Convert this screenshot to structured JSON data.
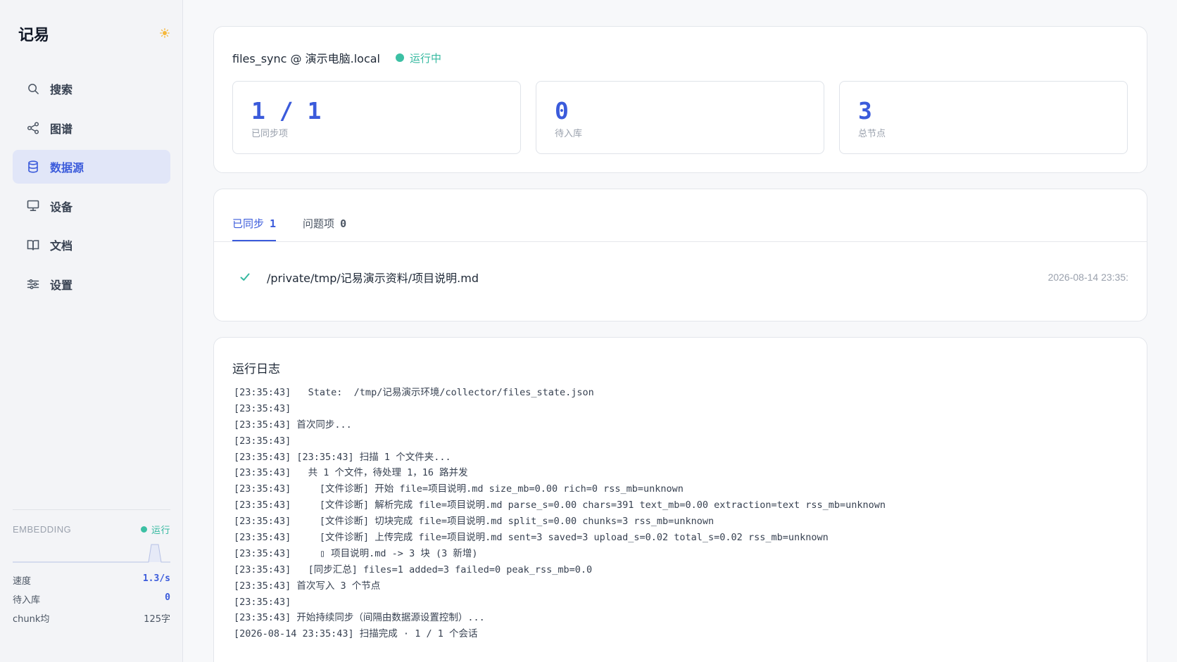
{
  "app": {
    "brand": "记易",
    "theme_icon": "sun-icon"
  },
  "sidebar": {
    "items": [
      {
        "label": "搜索",
        "icon": "search-icon"
      },
      {
        "label": "图谱",
        "icon": "graph-icon"
      },
      {
        "label": "数据源",
        "icon": "database-icon",
        "active": true
      },
      {
        "label": "设备",
        "icon": "monitor-icon"
      },
      {
        "label": "文档",
        "icon": "book-icon"
      },
      {
        "label": "设置",
        "icon": "sliders-icon"
      }
    ],
    "embedding": {
      "title": "EMBEDDING",
      "status": "运行",
      "stats": [
        {
          "label": "速度",
          "value": "1.3/s"
        },
        {
          "label": "待入库",
          "value": "0"
        },
        {
          "label": "chunk均",
          "value": "125字"
        }
      ]
    }
  },
  "source": {
    "name": "files_sync @ 演示电脑.local",
    "status": "运行中",
    "metrics": [
      {
        "value": "1 / 1",
        "label": "已同步项"
      },
      {
        "value": "0",
        "label": "待入库"
      },
      {
        "value": "3",
        "label": "总节点"
      }
    ]
  },
  "tabs": [
    {
      "label": "已同步",
      "count": "1",
      "active": true
    },
    {
      "label": "问题项",
      "count": "0"
    }
  ],
  "files": [
    {
      "path": "/private/tmp/记易演示资料/项目说明.md",
      "time": "2026-08-14 23:35:"
    }
  ],
  "log": {
    "title": "运行日志",
    "lines": [
      "[23:35:43]   State:  /tmp/记易演示环境/collector/files_state.json",
      "[23:35:43]",
      "[23:35:43] 首次同步...",
      "[23:35:43]",
      "[23:35:43] [23:35:43] 扫描 1 个文件夹...",
      "[23:35:43]   共 1 个文件，待处理 1，16 路并发",
      "[23:35:43]     [文件诊断] 开始 file=项目说明.md size_mb=0.00 rich=0 rss_mb=unknown",
      "[23:35:43]     [文件诊断] 解析完成 file=项目说明.md parse_s=0.00 chars=391 text_mb=0.00 extraction=text rss_mb=unknown",
      "[23:35:43]     [文件诊断] 切块完成 file=项目说明.md split_s=0.00 chunks=3 rss_mb=unknown",
      "[23:35:43]     [文件诊断] 上传完成 file=项目说明.md sent=3 saved=3 upload_s=0.02 total_s=0.02 rss_mb=unknown",
      "[23:35:43]     ▯ 项目说明.md -> 3 块 (3 新增)",
      "[23:35:43]   [同步汇总] files=1 added=3 failed=0 peak_rss_mb=0.0",
      "[23:35:43] 首次写入 3 个节点",
      "[23:35:43]",
      "[23:35:43] 开始持续同步（间隔由数据源设置控制）...",
      "[2026-08-14 23:35:43] 扫描完成 · 1 / 1 个会话"
    ]
  },
  "colors": {
    "accent": "#3b5bdb",
    "success": "#36b9a0",
    "active_bg": "#e1e6f8"
  }
}
